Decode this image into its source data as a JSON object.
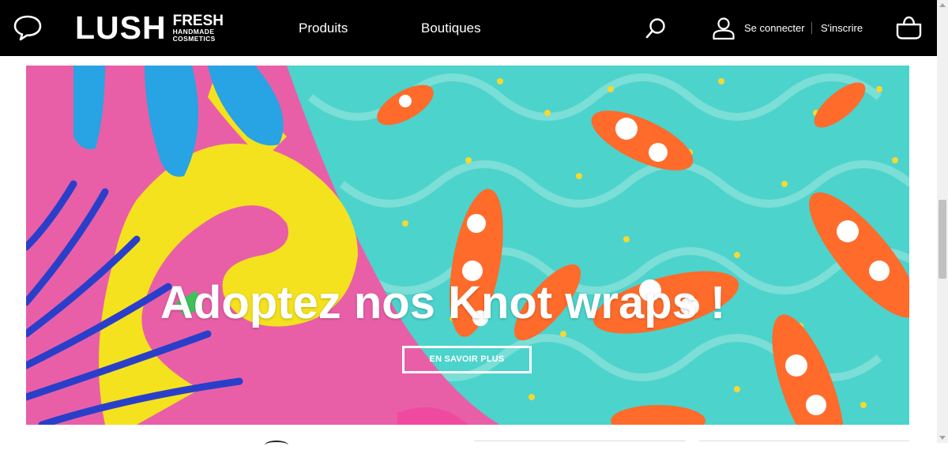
{
  "header": {
    "logo": {
      "main": "LUSH",
      "fresh": "FRESH",
      "line1": "HANDMADE",
      "line2": "COSMETICS"
    },
    "nav": [
      {
        "label": "Produits"
      },
      {
        "label": "Boutiques"
      }
    ],
    "login_label": "Se connecter",
    "signup_label": "S'inscrire",
    "icons": [
      "chat-icon",
      "search-icon",
      "user-icon",
      "basket-icon"
    ]
  },
  "hero": {
    "title": "Adoptez nos Knot wraps !",
    "cta_label": "EN SAVOIR PLUS"
  },
  "colors": {
    "header_bg": "#000000",
    "hero_pink": "#e85fa8",
    "hero_yellow": "#f4e21f",
    "hero_teal": "#4cd3cc",
    "hero_orange": "#ff6b2b",
    "hero_blue": "#2a3fc9"
  }
}
